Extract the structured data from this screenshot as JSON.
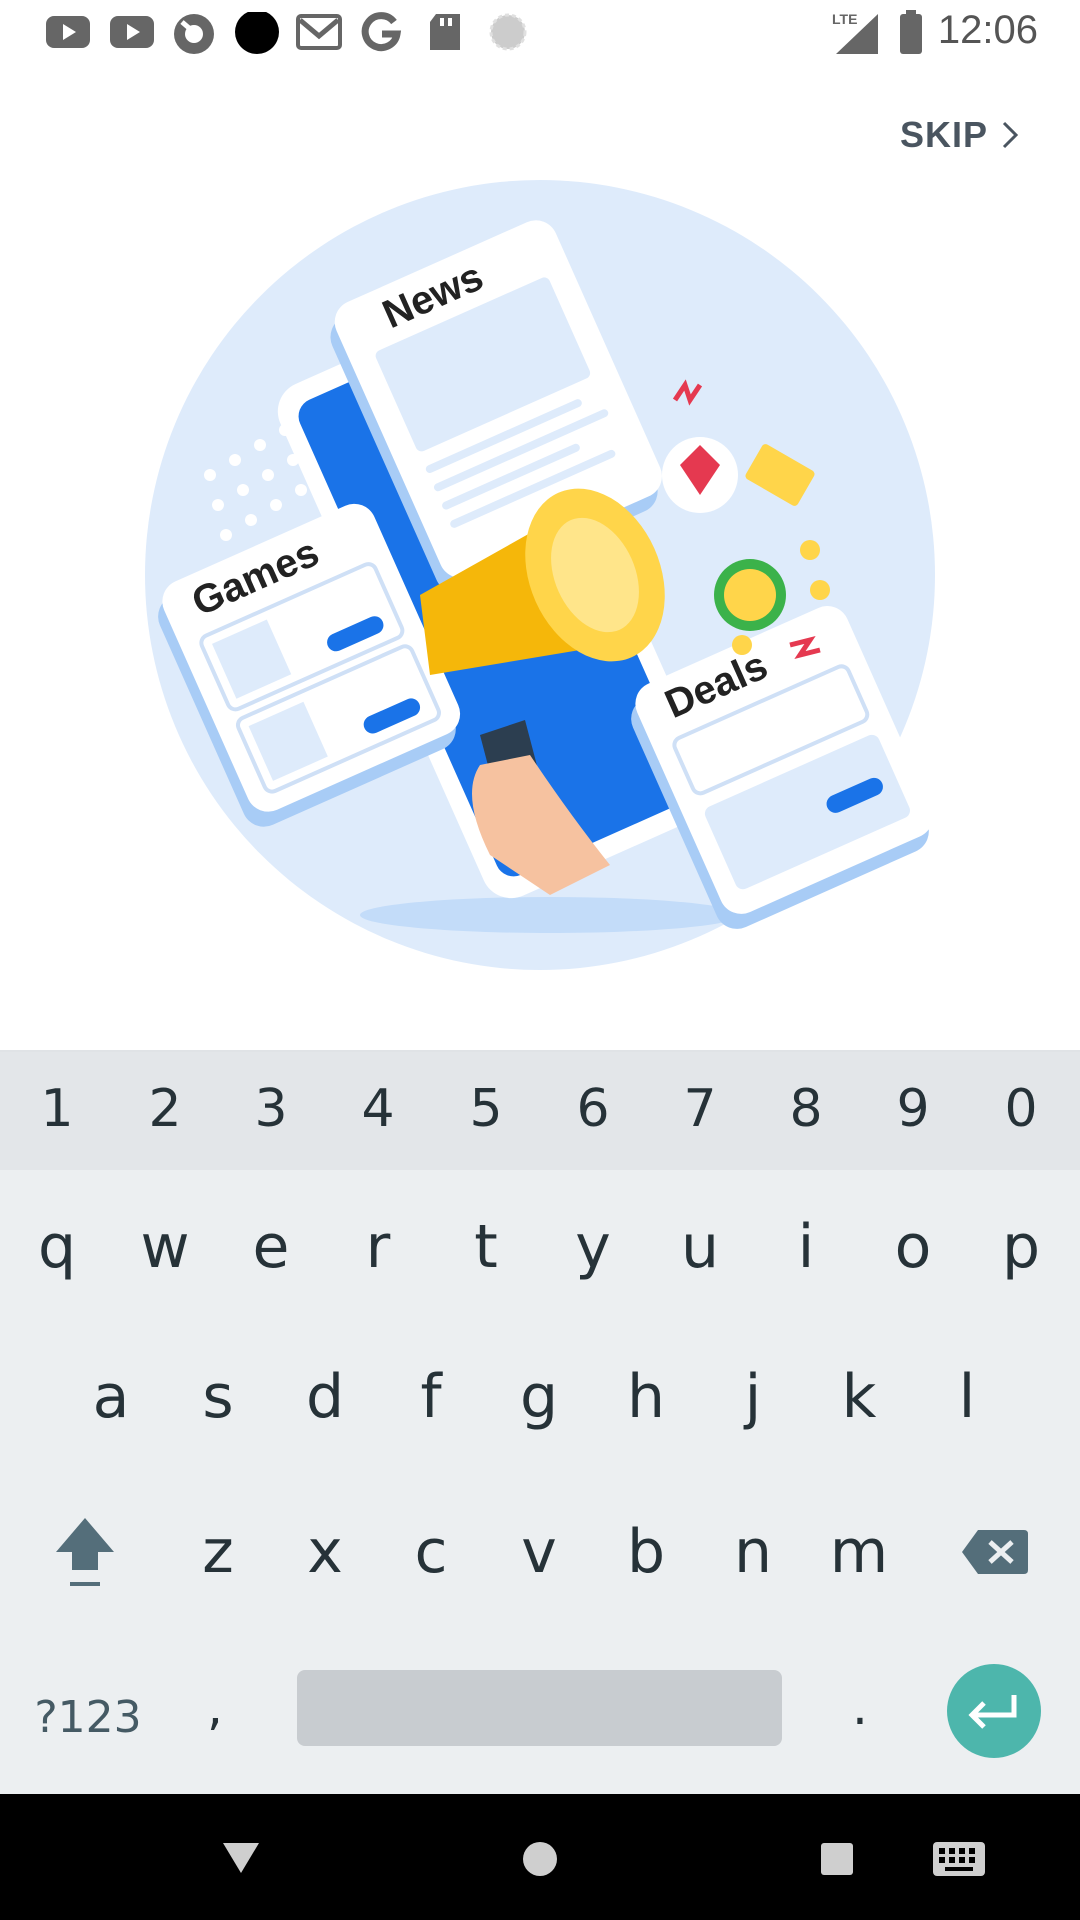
{
  "status_bar": {
    "time": "12:06",
    "network": "LTE",
    "notification_icons": [
      "youtube-icon",
      "youtube-icon",
      "app-icon",
      "dot-icon",
      "gmail-icon",
      "google-icon",
      "sd-card-icon",
      "loading-icon"
    ]
  },
  "onboarding": {
    "skip_label": "SKIP",
    "illustration_labels": {
      "news": "News",
      "games": "Games",
      "deals": "Deals"
    }
  },
  "keyboard": {
    "numbers": [
      "1",
      "2",
      "3",
      "4",
      "5",
      "6",
      "7",
      "8",
      "9",
      "0"
    ],
    "row1": [
      "q",
      "w",
      "e",
      "r",
      "t",
      "y",
      "u",
      "i",
      "o",
      "p"
    ],
    "row2": [
      "a",
      "s",
      "d",
      "f",
      "g",
      "h",
      "j",
      "k",
      "l"
    ],
    "row3": [
      "z",
      "x",
      "c",
      "v",
      "b",
      "n",
      "m"
    ],
    "symbols_label": "?123",
    "comma": ",",
    "period": "."
  },
  "colors": {
    "accent_enter": "#4db6ac",
    "illustration_blue": "#1a73e8",
    "illustration_bg": "#deebfb"
  }
}
